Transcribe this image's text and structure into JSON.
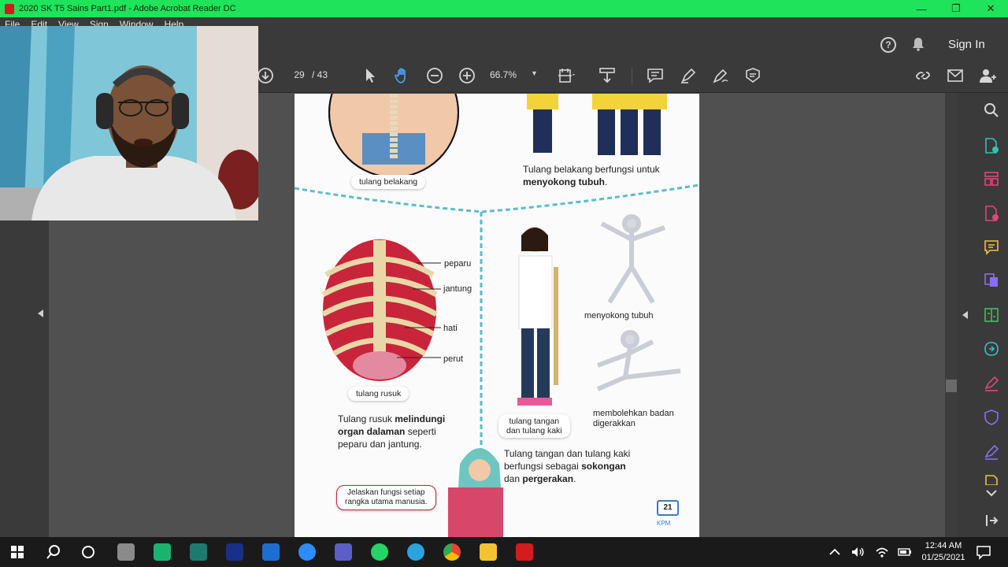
{
  "window": {
    "title": "2020 SK T5  Sains Part1.pdf - Adobe Acrobat Reader DC",
    "minimize": "—",
    "maximize": "❐",
    "close": "✕"
  },
  "menu": [
    "File",
    "Edit",
    "View",
    "Sign",
    "Window",
    "Help"
  ],
  "header": {
    "help": "?",
    "sign_in": "Sign In"
  },
  "toolbar": {
    "page_current": "29",
    "page_total": "/ 43",
    "zoom": "66.7%"
  },
  "page_content": {
    "spine_caption": "tulang belakang",
    "spine_text_1": "Tulang belakang berfungsi untuk",
    "spine_text_2": "menyokong tubuh",
    "spine_text_end": ".",
    "rib_labels": [
      "peparu",
      "jantung",
      "hati",
      "perut"
    ],
    "rib_caption": "tulang rusuk",
    "rib_text_1a": "Tulang rusuk ",
    "rib_text_1b": "melindungi",
    "rib_text_2a": "organ dalaman",
    "rib_text_2b": " seperti",
    "rib_text_3": "peparu dan jantung.",
    "girl_caption_1": "tulang tangan",
    "girl_caption_2": "dan tulang kaki",
    "skeleton1_caption": "menyokong tubuh",
    "skeleton2_caption_1": "membolehkan badan",
    "skeleton2_caption_2": "digerakkan",
    "limb_text_1": "Tulang tangan dan tulang kaki",
    "limb_text_2a": "berfungsi sebagai ",
    "limb_text_2b": "sokongan",
    "limb_text_3a": "dan ",
    "limb_text_3b": "pergerakan",
    "limb_text_3c": ".",
    "speech_1": "Jelaskan fungsi setiap",
    "speech_2": "rangka utama manusia.",
    "page_number": "21",
    "kpm": "KPM"
  },
  "taskbar": {
    "time": "12:44 AM",
    "date": "01/25/2021"
  },
  "colors": {
    "titlebar": "#1ee35b",
    "acrobat_red": "#d21b1b",
    "dashed_line": "#5bbccc",
    "rib_red": "#c8253a"
  }
}
